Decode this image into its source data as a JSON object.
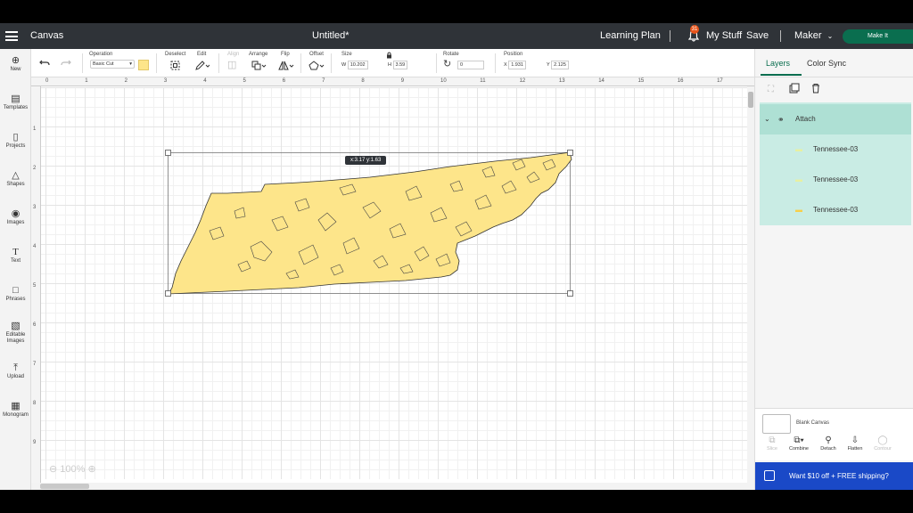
{
  "topbar": {
    "app_section": "Canvas",
    "doc_title": "Untitled*",
    "learning_plan": "Learning Plan",
    "notifications_count": "31",
    "my_stuff": "My Stuff",
    "save": "Save",
    "machine": "Maker",
    "make_it": "Make It"
  },
  "toolbar": {
    "operation_label": "Operation",
    "operation_value": "Basic Cut",
    "operation_color": "#fde58a",
    "deselect_label": "Deselect",
    "edit_label": "Edit",
    "align_label": "Align",
    "arrange_label": "Arrange",
    "flip_label": "Flip",
    "offset_label": "Offset",
    "size_label": "Size",
    "w_label": "W",
    "w_value": "10.202",
    "h_label": "H",
    "h_value": "3.59",
    "rotate_label": "Rotate",
    "rotate_value": "0",
    "position_label": "Position",
    "x_label": "X",
    "x_value": "1.931",
    "y_label": "Y",
    "y_value": "2.125"
  },
  "leftnav": {
    "items": [
      {
        "label": "New",
        "icon": "plus-circle-icon"
      },
      {
        "label": "Templates",
        "icon": "shirt-icon"
      },
      {
        "label": "Projects",
        "icon": "clipboard-icon"
      },
      {
        "label": "Shapes",
        "icon": "shapes-icon"
      },
      {
        "label": "Images",
        "icon": "lightbulb-icon"
      },
      {
        "label": "Text",
        "icon": "text-icon"
      },
      {
        "label": "Phrases",
        "icon": "speech-bubble-icon"
      },
      {
        "label": "Editable",
        "label2": "Images",
        "icon": "editable-image-icon"
      },
      {
        "label": "Upload",
        "icon": "upload-icon"
      },
      {
        "label": "Monogram",
        "icon": "monogram-icon"
      }
    ]
  },
  "canvas": {
    "ruler_top": [
      "0",
      "1",
      "2",
      "3",
      "4",
      "5",
      "6",
      "7",
      "8",
      "9",
      "10",
      "11",
      "12",
      "13",
      "14",
      "15",
      "16",
      "17"
    ],
    "ruler_left": [
      "1",
      "2",
      "3",
      "4",
      "5",
      "6",
      "7",
      "8",
      "9"
    ],
    "coords_tooltip": "x:3.17 y:1.63",
    "zoom": "100%",
    "shape_fill": "#fde58a"
  },
  "rightpanel": {
    "tab_layers": "Layers",
    "tab_color_sync": "Color Sync",
    "group_label": "Attach",
    "layers": [
      "Tennessee-03",
      "Tennessee-03",
      "Tennessee-03"
    ],
    "blank_canvas": "Blank Canvas",
    "tools": {
      "slice": "Slice",
      "combine": "Combine",
      "detach": "Detach",
      "flatten": "Flatten",
      "contour": "Contour"
    },
    "promo": "Want $10 off + FREE shipping?"
  }
}
